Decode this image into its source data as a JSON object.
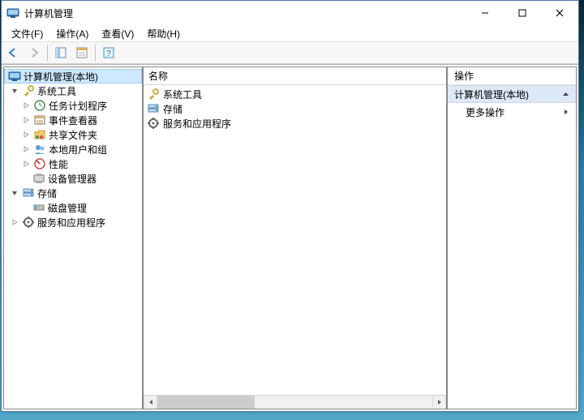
{
  "window": {
    "title": "计算机管理"
  },
  "menu": {
    "file": "文件(F)",
    "action": "操作(A)",
    "view": "查看(V)",
    "help": "帮助(H)"
  },
  "tree": {
    "root": "计算机管理(本地)",
    "sys_tools": "系统工具",
    "task_sched": "任务计划程序",
    "event_viewer": "事件查看器",
    "shared_folders": "共享文件夹",
    "local_users": "本地用户和组",
    "performance": "性能",
    "device_mgr": "设备管理器",
    "storage": "存储",
    "disk_mgmt": "磁盘管理",
    "services_apps": "服务和应用程序"
  },
  "mid": {
    "header_name": "名称",
    "items": {
      "sys_tools": "系统工具",
      "storage": "存储",
      "services_apps": "服务和应用程序"
    }
  },
  "actions": {
    "header": "操作",
    "context_title": "计算机管理(本地)",
    "more": "更多操作"
  }
}
